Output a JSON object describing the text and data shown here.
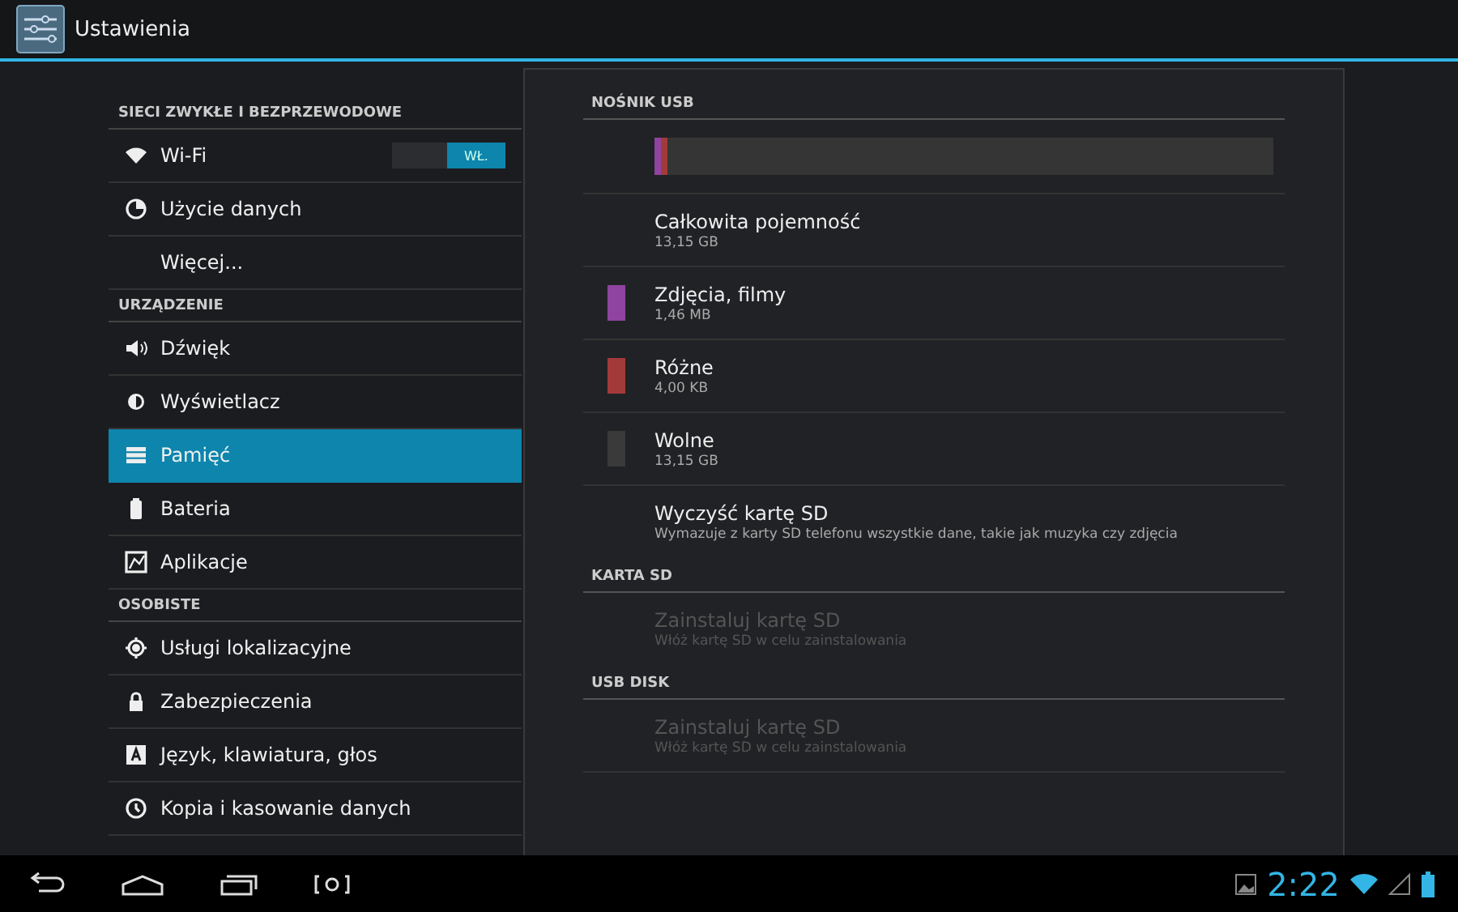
{
  "action_bar": {
    "title": "Ustawienia"
  },
  "sidebar": {
    "sections": [
      {
        "header": "SIECI ZWYKŁE I BEZPRZEWODOWE",
        "items": [
          {
            "kind": "wifi",
            "label": "Wi-Fi",
            "selected": false,
            "toggle": {
              "on": true,
              "label": "WŁ."
            }
          },
          {
            "kind": "data",
            "label": "Użycie danych",
            "selected": false
          },
          {
            "kind": "none",
            "label": "Więcej...",
            "selected": false
          }
        ]
      },
      {
        "header": "URZĄDZENIE",
        "items": [
          {
            "kind": "sound",
            "label": "Dźwięk",
            "selected": false
          },
          {
            "kind": "display",
            "label": "Wyświetlacz",
            "selected": false
          },
          {
            "kind": "storage",
            "label": "Pamięć",
            "selected": true
          },
          {
            "kind": "battery",
            "label": "Bateria",
            "selected": false
          },
          {
            "kind": "apps",
            "label": "Aplikacje",
            "selected": false
          }
        ]
      },
      {
        "header": "OSOBISTE",
        "items": [
          {
            "kind": "location",
            "label": "Usługi lokalizacyjne",
            "selected": false
          },
          {
            "kind": "lock",
            "label": "Zabezpieczenia",
            "selected": false
          },
          {
            "kind": "language",
            "label": "Język, klawiatura, głos",
            "selected": false
          },
          {
            "kind": "backup",
            "label": "Kopia i kasowanie danych",
            "selected": false
          }
        ]
      }
    ]
  },
  "detail": {
    "sections": [
      {
        "header": "NOŚNIK USB",
        "usage_bar": [
          {
            "color": "#8e44a0",
            "level": 0.006
          },
          {
            "color": "#a33a3a",
            "level": 0.004
          }
        ],
        "items": [
          {
            "title": "Całkowita pojemność",
            "summary": "13,15 GB",
            "disabled": false
          },
          {
            "title": "Zdjęcia, filmy",
            "summary": "1,46 MB",
            "color": "#8e44a0",
            "disabled": false
          },
          {
            "title": "Różne",
            "summary": "4,00 KB",
            "color": "#a33a3a",
            "disabled": false
          },
          {
            "title": "Wolne",
            "summary": "13,15 GB",
            "color": "#3a3a3a",
            "disabled": false
          },
          {
            "title": "Wyczyść kartę SD",
            "summary": "Wymazuje z karty SD telefonu wszystkie dane, takie jak muzyka czy zdjęcia",
            "disabled": false
          }
        ]
      },
      {
        "header": "KARTA SD",
        "items": [
          {
            "title": "Zainstaluj kartę SD",
            "summary": "Włóż kartę SD w celu zainstalowania",
            "disabled": true
          }
        ]
      },
      {
        "header": "USB DISK",
        "items": [
          {
            "title": "Zainstaluj kartę SD",
            "summary": "Włóż kartę SD w celu zainstalowania",
            "disabled": true
          }
        ]
      }
    ]
  },
  "system_bar": {
    "time": "2:22"
  }
}
